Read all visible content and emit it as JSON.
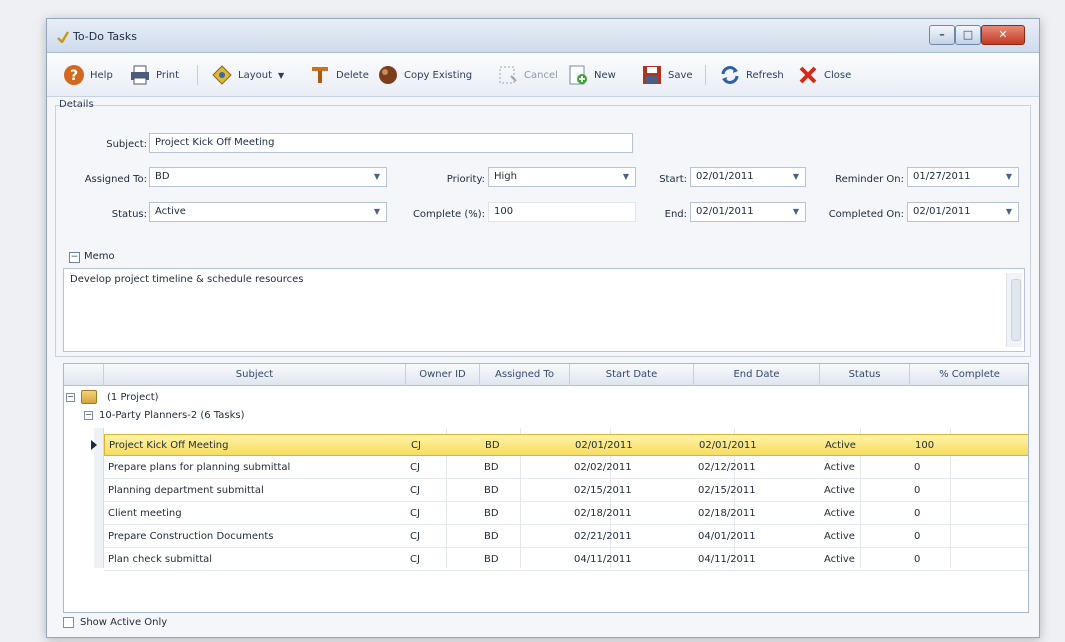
{
  "window": {
    "title": "To-Do Tasks"
  },
  "toolbar": {
    "help": "Help",
    "print": "Print",
    "layout": "Layout",
    "delete": "Delete",
    "copy_existing": "Copy Existing",
    "cancel": "Cancel",
    "new": "New",
    "save": "Save",
    "refresh": "Refresh",
    "close": "Close"
  },
  "details": {
    "section_label": "Details",
    "subject_label": "Subject:",
    "subject_value": "Project Kick Off Meeting",
    "assigned_label": "Assigned To:",
    "assigned_value": "BD",
    "priority_label": "Priority:",
    "priority_value": "High",
    "start_label": "Start:",
    "start_value": "02/01/2011",
    "reminder_label": "Reminder On:",
    "reminder_value": "01/27/2011",
    "status_label": "Status:",
    "status_value": "Active",
    "complete_label": "Complete (%):",
    "complete_value": "100",
    "end_label": "End:",
    "end_value": "02/01/2011",
    "completed_label": "Completed On:",
    "completed_value": "02/01/2011"
  },
  "memo": {
    "label": "Memo",
    "text": "Develop project timeline & schedule resources"
  },
  "grid": {
    "columns": [
      "Subject",
      "Owner ID",
      "Assigned To",
      "Start Date",
      "End Date",
      "Status",
      "% Complete"
    ],
    "group1": "(1 Project)",
    "group2": "10-Party Planners-2 (6 Tasks)",
    "rows": [
      {
        "subject": "Project Kick Off Meeting",
        "owner": "CJ",
        "assigned": "BD",
        "start": "02/01/2011",
        "end": "02/01/2011",
        "status": "Active",
        "complete": "100"
      },
      {
        "subject": "Prepare plans for planning submittal",
        "owner": "CJ",
        "assigned": "BD",
        "start": "02/02/2011",
        "end": "02/12/2011",
        "status": "Active",
        "complete": "0"
      },
      {
        "subject": "Planning department submittal",
        "owner": "CJ",
        "assigned": "BD",
        "start": "02/15/2011",
        "end": "02/15/2011",
        "status": "Active",
        "complete": "0"
      },
      {
        "subject": "Client meeting",
        "owner": "CJ",
        "assigned": "BD",
        "start": "02/18/2011",
        "end": "02/18/2011",
        "status": "Active",
        "complete": "0"
      },
      {
        "subject": "Prepare Construction Documents",
        "owner": "CJ",
        "assigned": "BD",
        "start": "02/21/2011",
        "end": "04/01/2011",
        "status": "Active",
        "complete": "0"
      },
      {
        "subject": "Plan check submittal",
        "owner": "CJ",
        "assigned": "BD",
        "start": "04/11/2011",
        "end": "04/11/2011",
        "status": "Active",
        "complete": "0"
      }
    ]
  },
  "footer": {
    "show_active_only": "Show Active Only"
  },
  "icons": {
    "help": "help-icon",
    "print": "print-icon",
    "layout": "layout-icon",
    "delete": "delete-icon",
    "copy": "copy-icon",
    "cancel": "cancel-icon",
    "new": "new-icon",
    "save": "save-icon",
    "refresh": "refresh-icon",
    "close": "close-icon"
  },
  "colors": {
    "selected_row": "#f7dc5f",
    "close_x": "#d42a1a",
    "help": "#d2691e"
  }
}
